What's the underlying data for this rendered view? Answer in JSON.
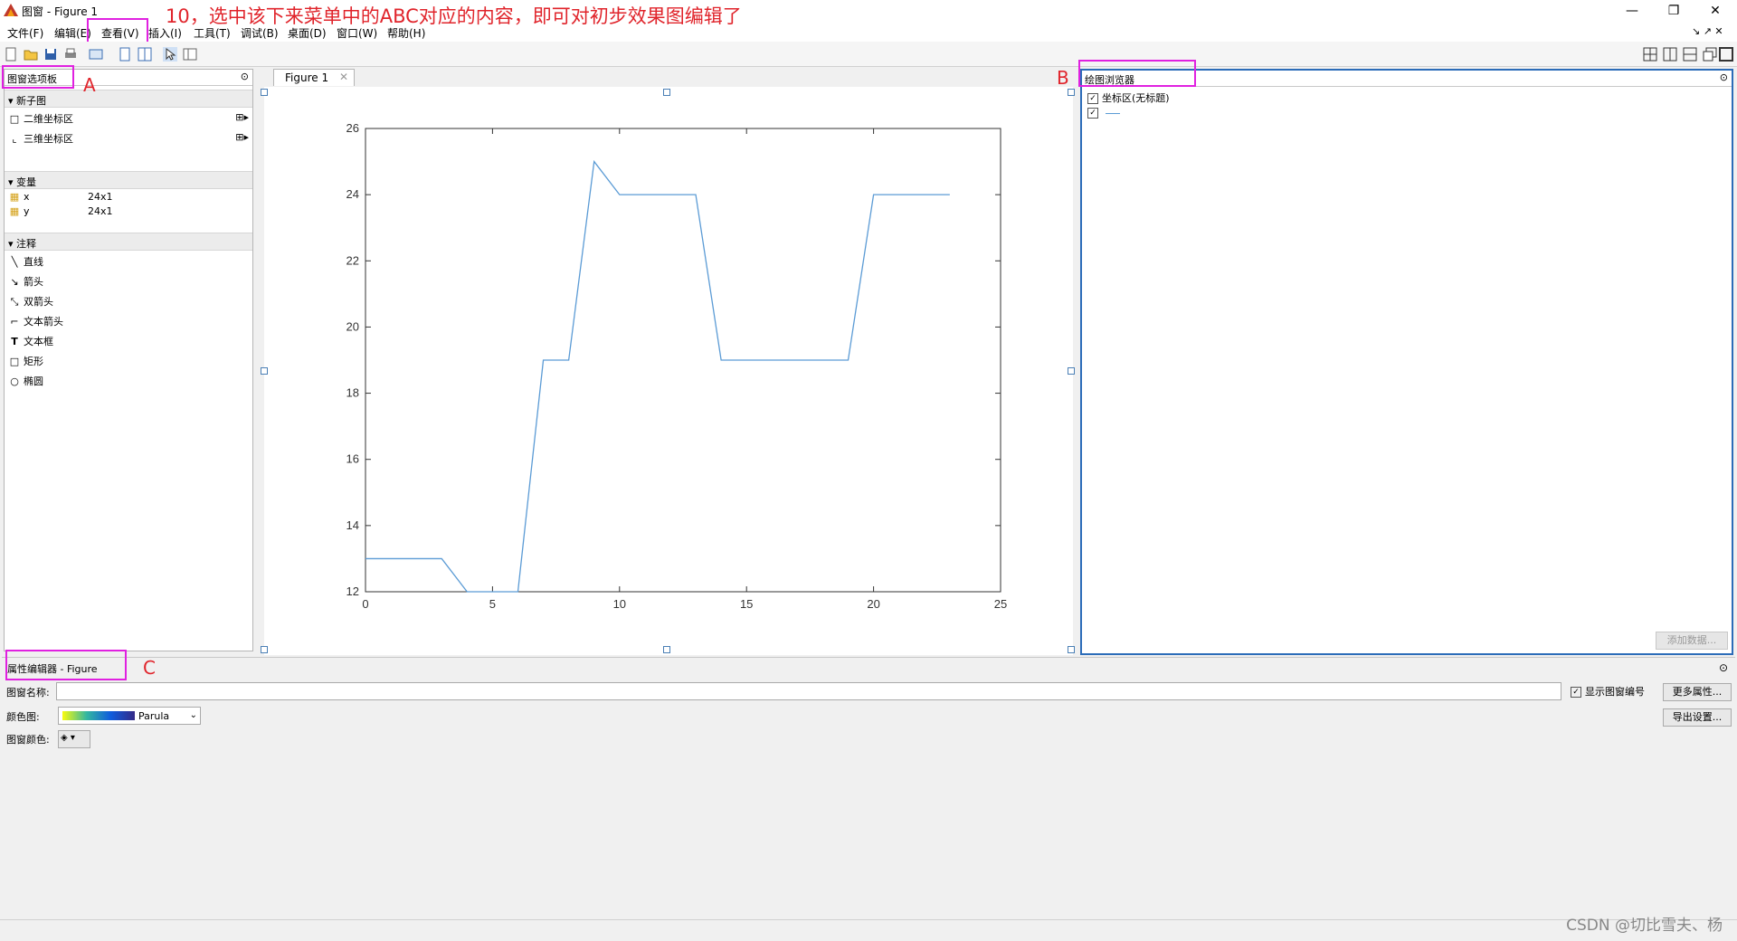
{
  "window": {
    "title": "图窗 - Figure 1"
  },
  "menu": [
    "文件(F)",
    "编辑(E)",
    "查看(V)",
    "插入(I)",
    "工具(T)",
    "调试(B)",
    "桌面(D)",
    "窗口(W)",
    "帮助(H)"
  ],
  "annotation": {
    "text": "10，选中该下来菜单中的ABC对应的内容，即可对初步效果图编辑了",
    "letters": [
      "A",
      "B",
      "C"
    ]
  },
  "left_panel": {
    "title": "图窗选项板",
    "sections": {
      "new_subplot": "新子图",
      "items_subplot": [
        "二维坐标区",
        "三维坐标区"
      ],
      "variables": "变量",
      "vars": [
        {
          "name": "x",
          "size": "24x1"
        },
        {
          "name": "y",
          "size": "24x1"
        }
      ],
      "annotations": "注释",
      "annot_items": [
        "直线",
        "箭头",
        "双箭头",
        "文本箭头",
        "文本框",
        "矩形",
        "椭圆"
      ]
    }
  },
  "figure_tab": {
    "label": "Figure 1"
  },
  "plot_browser": {
    "title": "绘图浏览器",
    "items": [
      "坐标区(无标题)",
      ""
    ],
    "add_data": "添加数据..."
  },
  "property_editor": {
    "title": "属性编辑器 - Figure",
    "name_label": "图窗名称:",
    "colormap_label": "颜色图:",
    "colormap_value": "Parula",
    "color_label": "图窗颜色:",
    "show_number": "显示图窗编号",
    "more_props": "更多属性...",
    "export_settings": "导出设置..."
  },
  "watermark": "CSDN @切比雪夫、杨",
  "chart_data": {
    "type": "line",
    "x": [
      0,
      1,
      2,
      3,
      4,
      5,
      6,
      7,
      8,
      9,
      10,
      11,
      12,
      13,
      14,
      15,
      16,
      17,
      18,
      19,
      20,
      21,
      22,
      23
    ],
    "y": [
      13,
      13,
      13,
      13,
      12,
      12,
      12,
      19,
      19,
      25,
      24,
      24,
      24,
      24,
      19,
      19,
      19,
      19,
      19,
      19,
      24,
      24,
      24,
      24
    ],
    "xlim": [
      0,
      25
    ],
    "ylim": [
      12,
      26
    ],
    "xticks": [
      0,
      5,
      10,
      15,
      20,
      25
    ],
    "yticks": [
      12,
      14,
      16,
      18,
      20,
      22,
      24,
      26
    ],
    "line_color": "#5b9bd5",
    "grid": false
  }
}
